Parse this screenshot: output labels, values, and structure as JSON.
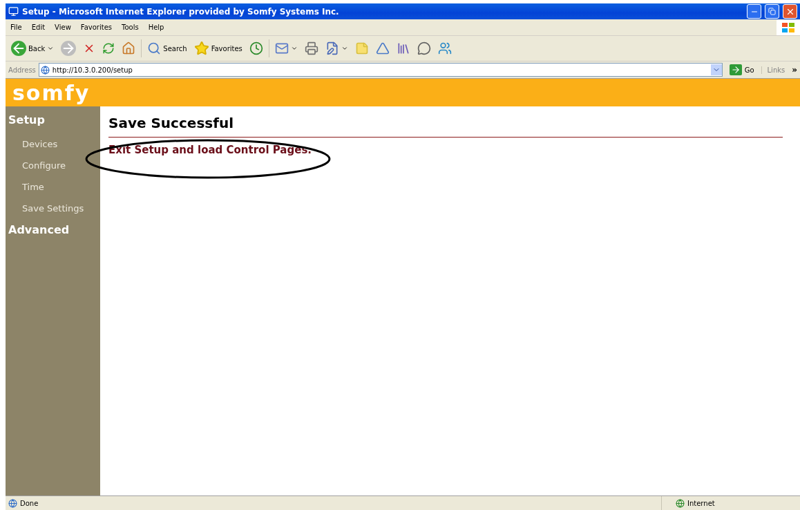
{
  "window": {
    "title": "Setup - Microsoft Internet Explorer provided by Somfy Systems Inc."
  },
  "menu": [
    "File",
    "Edit",
    "View",
    "Favorites",
    "Tools",
    "Help"
  ],
  "toolbar": {
    "back": "Back",
    "search": "Search",
    "favorites": "Favorites"
  },
  "address_bar": {
    "label": "Address",
    "url": "http://10.3.0.200/setup",
    "go": "Go",
    "links": "Links",
    "more": "»"
  },
  "header": {
    "logo": "somfy"
  },
  "sidebar": {
    "sections": [
      {
        "title": "Setup",
        "items": [
          "Devices",
          "Configure",
          "Time",
          "Save Settings"
        ]
      },
      {
        "title": "Advanced"
      }
    ]
  },
  "content": {
    "heading": "Save Successful",
    "link": "Exit Setup and load Control Pages.",
    "link_circled": true
  },
  "status_bar": {
    "status": "Done",
    "zone": "Internet"
  }
}
